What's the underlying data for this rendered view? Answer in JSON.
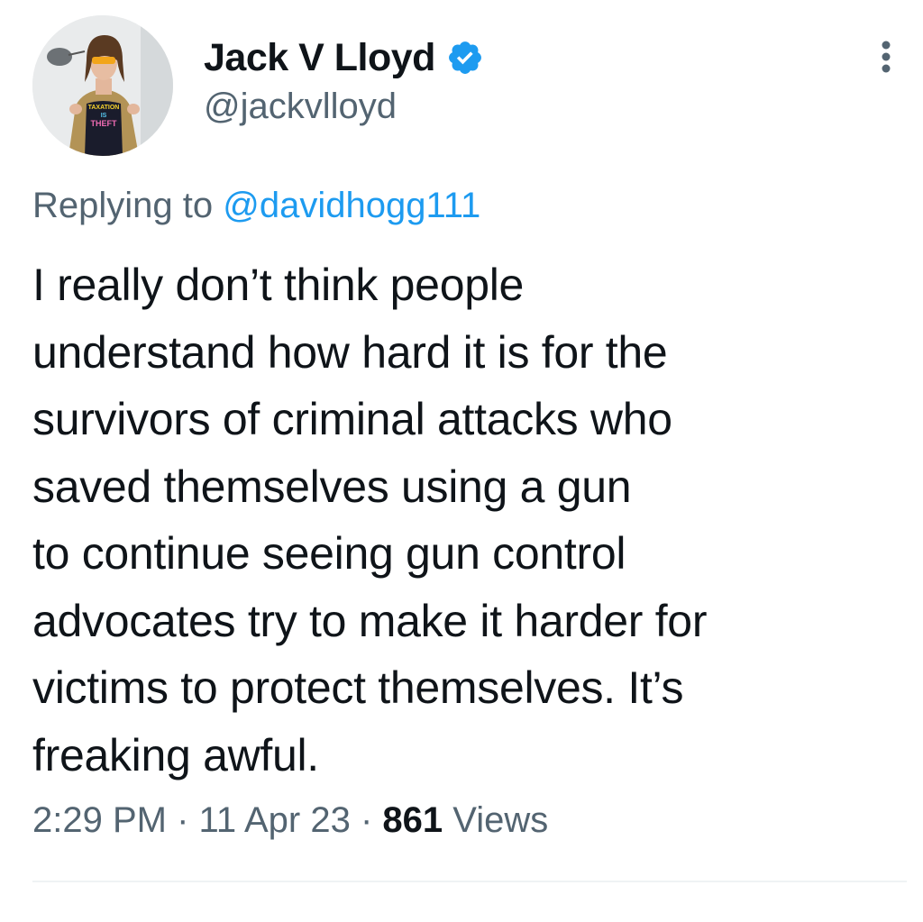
{
  "tweet": {
    "author": {
      "display_name": "Jack V Lloyd",
      "handle": "@jackvlloyd",
      "verified": true,
      "avatar_shirt_text": [
        "TAXATION",
        "IS",
        "THEFT"
      ]
    },
    "replying_prefix": "Replying to ",
    "replying_to": "@davidhogg111",
    "text": "I really don’t think people\nunderstand how hard it is for the\nsurvivors of criminal attacks who\nsaved themselves using a gun\nto continue seeing gun control\nadvocates try to make it harder for\nvictims to protect themselves. It’s\nfreaking awful.",
    "time": "2:29 PM",
    "date": "11 Apr 23",
    "separator": "·",
    "views_count": "861",
    "views_label": "Views"
  },
  "colors": {
    "text_primary": "#0f1419",
    "text_secondary": "#536471",
    "accent": "#1d9bf0",
    "divider": "#eff3f4"
  },
  "icons": {
    "verified": "verified-badge-icon",
    "more": "more-options-icon"
  }
}
